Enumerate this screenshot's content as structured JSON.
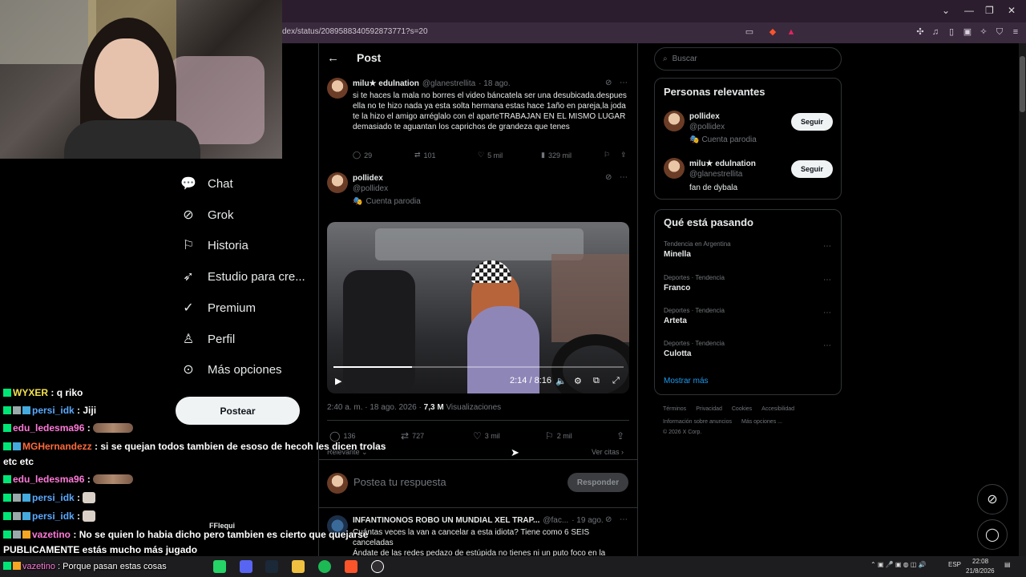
{
  "browser": {
    "url": "dex/status/2089588340592873771?s=20",
    "window_controls": [
      "⌄",
      "—",
      "❐",
      "✕"
    ]
  },
  "nav": {
    "items": [
      {
        "label": "Chat",
        "icon": "chat-icon",
        "glyph": "◯"
      },
      {
        "label": "Grok",
        "icon": "grok-icon",
        "glyph": "⊘"
      },
      {
        "label": "Historia",
        "icon": "bookmark-icon",
        "glyph": "🔖"
      },
      {
        "label": "Estudio para cre...",
        "icon": "rocket-icon",
        "glyph": "➶"
      },
      {
        "label": "Premium",
        "icon": "verified-icon",
        "glyph": "✓"
      },
      {
        "label": "Perfil",
        "icon": "person-icon",
        "glyph": "♙"
      },
      {
        "label": "Más opciones",
        "icon": "more-icon",
        "glyph": "⋯"
      }
    ],
    "post_button": "Postear"
  },
  "post_header": {
    "back": "←",
    "title": "Post"
  },
  "tweet1": {
    "name": "milu★ edulnation",
    "handle": "@glanestrellita",
    "time": "· 18 ago.",
    "text": "si te haces la mala no borres el video báncatela ser una desubicada.despues ella no te hizo nada ya esta solta hermana estas hace 1año en pareja,la joda te la hizo el amigo arréglalo con el aparteTRABAJAN EN EL MISMO LUGAR demasiado te aguantan los caprichos de grandeza que tenes",
    "replies": "29",
    "retweets": "101",
    "likes": "5 mil",
    "views": "329 mil"
  },
  "tweet2": {
    "name": "pollidex",
    "handle": "@pollidex",
    "parody": "Cuenta parodia",
    "video_time": "2:14 / 8:16",
    "video_progress": 0.27,
    "meta_time": "2:40 a. m. · 18 ago. 2026 ·",
    "views_count": "7,3 M",
    "views_label": "Visualizaciones",
    "replies": "136",
    "retweets": "727",
    "likes": "3 mil",
    "bookmarks": "2 mil",
    "sort_label": "Relevante",
    "quotes_label": "Ver citas"
  },
  "reply": {
    "placeholder": "Postea tu respuesta",
    "button": "Responder"
  },
  "tweet3": {
    "name": "INFANTINONOS ROBO UN MUNDIAL XEL TRAP...",
    "handle": "@fac...",
    "time": "· 19 ago.",
    "text1": "Cuántas veces la van a cancelar a esta idiota? Tiene como 6 SEIS",
    "text2": "canceladas",
    "text3": "Ándate de las redes pedazo de estúpida no tienes ni un puto foco en la"
  },
  "search": {
    "placeholder": "Buscar"
  },
  "relevant": {
    "title": "Personas relevantes",
    "people": [
      {
        "name": "pollidex",
        "handle": "@pollidex",
        "bio": "Cuenta parodia",
        "button": "Seguir"
      },
      {
        "name": "milu★ edulnation",
        "handle": "@glanestrellita",
        "bio": "fan de dybala",
        "button": "Seguir"
      }
    ]
  },
  "trends": {
    "title": "Qué está pasando",
    "items": [
      {
        "context": "Tendencia en Argentina",
        "name": "Minella"
      },
      {
        "context": "Deportes · Tendencia",
        "name": "Franco"
      },
      {
        "context": "Deportes · Tendencia",
        "name": "Arteta"
      },
      {
        "context": "Deportes · Tendencia",
        "name": "Culotta"
      }
    ],
    "more": "Mostrar más"
  },
  "footer": {
    "links": [
      "Términos",
      "Privacidad",
      "Cookies",
      "Accesibilidad"
    ],
    "links2": [
      "Información sobre anuncios",
      "Más opciones ..."
    ],
    "copyright": "© 2026 X Corp."
  },
  "chat": [
    {
      "user": "WYXER",
      "color": "#f3e14b",
      "msg": ": q riko"
    },
    {
      "user": "persi_idk",
      "color": "#5aa9ff",
      "msg": ": Jiji"
    },
    {
      "user": "edu_ledesma96",
      "color": "#ff7ad9",
      "msg": ":"
    },
    {
      "user": "MGHernandezz",
      "color": "#ff6a3d",
      "msg": ": si se quejan todos tambien de esoso de hecoh les dicen trolas",
      "wrap": "etc etc"
    },
    {
      "user": "edu_ledesma96",
      "color": "#ff7ad9",
      "msg": ":"
    },
    {
      "user": "persi_idk",
      "color": "#5aa9ff",
      "msg": ":"
    },
    {
      "user": "persi_idk",
      "color": "#5aa9ff",
      "msg": ":"
    },
    {
      "user": "vazetino",
      "color": "#ff7ad9",
      "msg": ": No se quien lo habia dicho pero tambien es cierto que quejarse",
      "wrap": "PUBLICAMENTE estás mucho más jugado"
    },
    {
      "user": "vazetino",
      "color": "#ff7ad9",
      "msg": ": Porque pasan estas cosas"
    }
  ],
  "overlay_name": "FFlequi",
  "taskbar": {
    "lang": "ESP",
    "time": "22:08",
    "date": "21/8/2026"
  }
}
